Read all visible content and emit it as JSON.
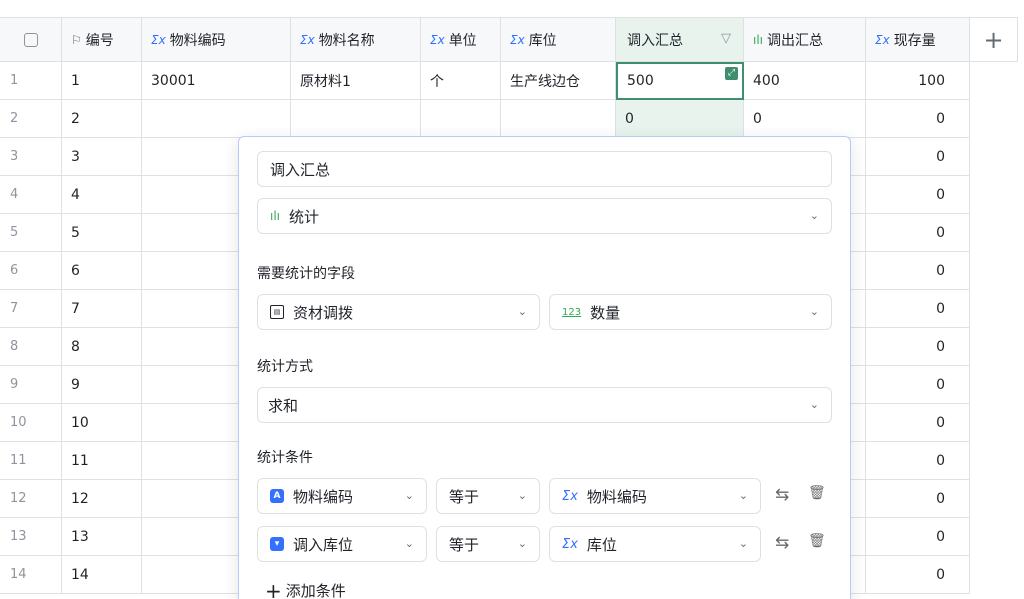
{
  "columns": [
    {
      "label": "",
      "icon": "checkbox"
    },
    {
      "label": "编号",
      "icon": "flag-icon",
      "icon_glyph": "⚐"
    },
    {
      "label": "物料编码",
      "icon": "formula-icon",
      "icon_glyph": "Σx"
    },
    {
      "label": "物料名称",
      "icon": "formula-icon",
      "icon_glyph": "Σx"
    },
    {
      "label": "单位",
      "icon": "formula-icon",
      "icon_glyph": "Σx"
    },
    {
      "label": "库位",
      "icon": "formula-icon",
      "icon_glyph": "Σx"
    },
    {
      "label": "调入汇总",
      "icon": "",
      "icon_glyph": ""
    },
    {
      "label": "调出汇总",
      "icon": "stats-icon",
      "icon_glyph": "ılı"
    },
    {
      "label": "现存量",
      "icon": "formula-icon",
      "icon_glyph": "Σx"
    }
  ],
  "add_column_glyph": "+",
  "rows": [
    {
      "idx": "1",
      "no": "1",
      "code": "30001",
      "name": "原材料1",
      "unit": "个",
      "loc": "生产线边仓",
      "in": "500",
      "out": "400",
      "stock": "100"
    },
    {
      "idx": "2",
      "no": "2",
      "code": "",
      "name": "",
      "unit": "",
      "loc": "",
      "in": "0",
      "out": "0",
      "stock": "0"
    },
    {
      "idx": "3",
      "no": "3",
      "stock": "0"
    },
    {
      "idx": "4",
      "no": "4",
      "stock": "0"
    },
    {
      "idx": "5",
      "no": "5",
      "stock": "0"
    },
    {
      "idx": "6",
      "no": "6",
      "stock": "0"
    },
    {
      "idx": "7",
      "no": "7",
      "stock": "0"
    },
    {
      "idx": "8",
      "no": "8",
      "stock": "0"
    },
    {
      "idx": "9",
      "no": "9",
      "stock": "0"
    },
    {
      "idx": "10",
      "no": "10",
      "stock": "0"
    },
    {
      "idx": "11",
      "no": "11",
      "stock": "0"
    },
    {
      "idx": "12",
      "no": "12",
      "stock": "0"
    },
    {
      "idx": "13",
      "no": "13",
      "stock": "0"
    },
    {
      "idx": "14",
      "no": "14",
      "stock": "0"
    }
  ],
  "panel": {
    "field_name": "调入汇总",
    "field_type": "统计",
    "field_type_icon": "ılı",
    "stat_field_label": "需要统计的字段",
    "source_table": "资材调拨",
    "source_table_icon": "▤",
    "source_field": "数量",
    "source_field_icon": "123",
    "method_label": "统计方式",
    "method": "求和",
    "conditions_label": "统计条件",
    "conditions": [
      {
        "field": "物料编码",
        "field_icon": "A",
        "op": "等于",
        "value": "物料编码",
        "value_icon": "Σx"
      },
      {
        "field": "调入库位",
        "field_icon": "▾",
        "op": "等于",
        "value": "库位",
        "value_icon": "Σx"
      }
    ],
    "add_condition": "添加条件",
    "add_glyph": "+",
    "chevron": "⌄",
    "swap_glyph": "⇆",
    "delete_glyph": "🗑"
  },
  "colors": {
    "accent": "#3370ff",
    "selected_col": "#e8f3ee",
    "active_border": "#3f8f6e"
  }
}
